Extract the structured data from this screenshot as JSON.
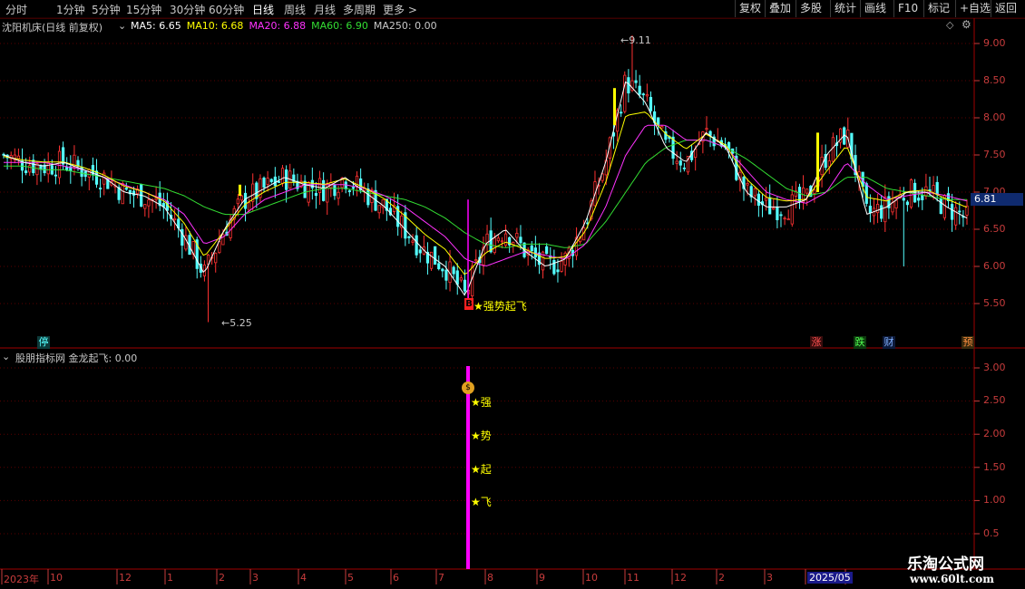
{
  "toolbar": {
    "periods": [
      "分时",
      "1分钟",
      "5分钟",
      "15分钟",
      "30分钟",
      "60分钟",
      "日线",
      "周线",
      "月线",
      "多周期",
      "更多"
    ],
    "more_arrow": ">",
    "buttons": [
      "复权",
      "叠加",
      "多股",
      "统计",
      "画线",
      "F10",
      "标记",
      "+自选",
      "返回"
    ]
  },
  "main_chart": {
    "title": "沈阳机床(日线 前复权)",
    "ma": [
      {
        "label": "MA5: 6.65",
        "color": "#ffffff"
      },
      {
        "label": "MA10: 6.68",
        "color": "#ffff00"
      },
      {
        "label": "MA20: 6.88",
        "color": "#ff33ff"
      },
      {
        "label": "MA60: 6.90",
        "color": "#33dd33"
      },
      {
        "label": "MA250: 0.00",
        "color": "#c8c8c8"
      }
    ],
    "high_label": "9.11",
    "low_label": "5.25",
    "current_price": "6.81",
    "buy_marker": "B",
    "signal_text": "★强势起飞",
    "event_markers": [
      "停",
      "涨",
      "跌",
      "财",
      "预"
    ]
  },
  "indicator_panel": {
    "title": "股朋指标网 金龙起飞: 0.00",
    "signal_chars": [
      "★强",
      "★势",
      "★起",
      "★飞"
    ],
    "money_icon": "money-bag-icon"
  },
  "price_axis": [
    "9.00",
    "8.50",
    "8.00",
    "7.50",
    "7.00",
    "6.50",
    "6.00",
    "5.50"
  ],
  "indicator_axis": [
    "3.00",
    "2.50",
    "2.00",
    "1.50",
    "1.00",
    "0.5"
  ],
  "date_axis": [
    "2023年",
    "10",
    "12",
    "1",
    "2",
    "3",
    "4",
    "5",
    "6",
    "7",
    "8",
    "9",
    "10",
    "11",
    "12",
    "2",
    "3",
    "2025/05"
  ],
  "watermark": {
    "line1": "乐淘公式网",
    "line2": "www.60lt.com"
  },
  "colors": {
    "up": "#ff3232",
    "down": "#54ffff",
    "axis": "#c83c3c",
    "ma5": "#ffffff",
    "ma10": "#ffff00",
    "ma20": "#ff33ff",
    "ma60": "#33dd33",
    "signal": "#ff00ff"
  },
  "chart_data": {
    "type": "candlestick",
    "price_range": [
      5.1,
      9.3
    ],
    "high": 9.11,
    "low": 5.25,
    "ma5_approx": [
      7.5,
      7.4,
      7.35,
      7.4,
      7.3,
      7.2,
      7.0,
      6.95,
      6.8,
      6.4,
      5.9,
      6.5,
      6.9,
      7.05,
      7.2,
      7.1,
      7.05,
      7.2,
      7.0,
      6.8,
      6.5,
      6.2,
      6.0,
      5.6,
      6.3,
      6.5,
      6.2,
      6.0,
      6.1,
      6.6,
      7.4,
      8.5,
      8.2,
      7.6,
      7.4,
      7.8,
      7.6,
      7.0,
      6.8,
      6.8,
      6.9,
      7.5,
      7.8,
      6.7,
      6.8,
      7.0,
      7.0,
      6.8,
      6.65
    ],
    "ma20_approx": [
      7.4,
      7.4,
      7.4,
      7.35,
      7.3,
      7.2,
      7.1,
      7.0,
      6.9,
      6.7,
      6.3,
      6.4,
      6.7,
      6.9,
      7.0,
      7.1,
      7.1,
      7.1,
      7.05,
      6.95,
      6.8,
      6.6,
      6.4,
      6.1,
      6.0,
      6.1,
      6.2,
      6.15,
      6.1,
      6.3,
      6.8,
      7.5,
      7.9,
      7.9,
      7.7,
      7.7,
      7.6,
      7.3,
      7.0,
      6.9,
      6.85,
      7.0,
      7.4,
      7.1,
      6.9,
      6.95,
      7.0,
      6.95,
      6.88
    ],
    "ma60_approx": [
      7.35,
      7.35,
      7.3,
      7.3,
      7.25,
      7.2,
      7.15,
      7.1,
      7.05,
      6.95,
      6.8,
      6.7,
      6.7,
      6.8,
      6.9,
      7.0,
      7.05,
      7.05,
      7.0,
      6.95,
      6.9,
      6.8,
      6.65,
      6.45,
      6.3,
      6.25,
      6.3,
      6.3,
      6.25,
      6.3,
      6.6,
      7.0,
      7.4,
      7.6,
      7.7,
      7.7,
      7.6,
      7.45,
      7.25,
      7.05,
      6.95,
      7.0,
      7.2,
      7.2,
      7.05,
      7.0,
      6.95,
      6.9,
      6.9
    ]
  }
}
